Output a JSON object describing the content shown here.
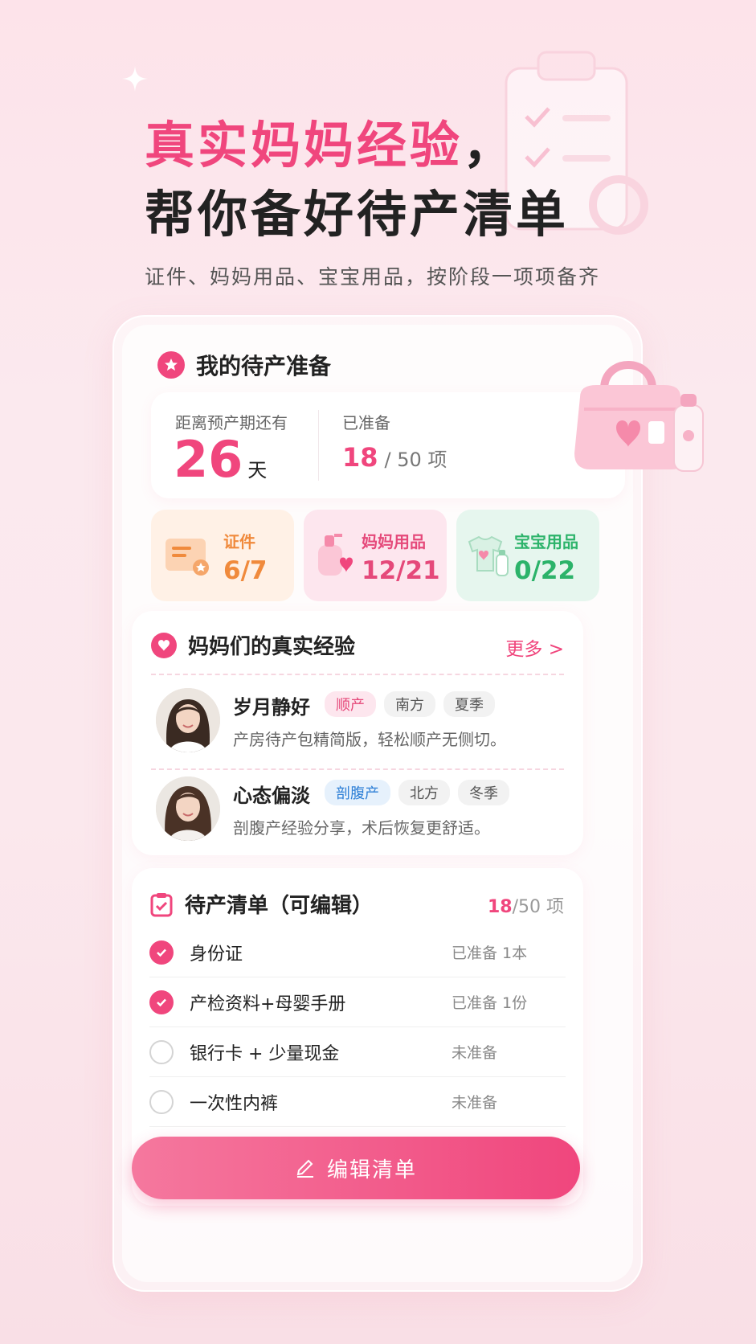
{
  "hero": {
    "line1_highlight": "真实妈妈经验",
    "line1_punct": "，",
    "line2": "帮你备好待产清单",
    "subtitle": "证件、妈妈用品、宝宝用品，按阶段一项项备齐"
  },
  "prep": {
    "title": "我的待产准备",
    "days_label": "距离预产期还有",
    "days_value": "26",
    "days_unit": "天",
    "ready_label": "已准备",
    "ready_value": "18",
    "ready_rest": "/ 50 项"
  },
  "categories": [
    {
      "label": "证件",
      "value": "6/7",
      "icon": "certificate-icon"
    },
    {
      "label": "妈妈用品",
      "value": "12/21",
      "icon": "lotion-icon"
    },
    {
      "label": "宝宝用品",
      "value": "0/22",
      "icon": "baby-clothes-icon"
    }
  ],
  "experience": {
    "title": "妈妈们的真实经验",
    "more": "更多 >",
    "items": [
      {
        "name": "岁月静好",
        "tags": [
          "顺产",
          "南方",
          "夏季"
        ],
        "desc": "产房待产包精简版，轻松顺产无侧切。"
      },
      {
        "name": "心态偏淡",
        "tags": [
          "剖腹产",
          "北方",
          "冬季"
        ],
        "desc": "剖腹产经验分享，术后恢复更舒适。"
      }
    ]
  },
  "checklist": {
    "title": "待产清单（可编辑）",
    "count_done": "18",
    "count_rest": "/50 项",
    "items": [
      {
        "label": "身份证",
        "status": "已准备 1本",
        "checked": true
      },
      {
        "label": "产检资料+母婴手册",
        "status": "已准备 1份",
        "checked": true
      },
      {
        "label": "银行卡 + 少量现金",
        "status": "未准备",
        "checked": false
      },
      {
        "label": "一次性内裤",
        "status": "未准备",
        "checked": false
      }
    ]
  },
  "edit_button": {
    "label": "编辑清单"
  },
  "colors": {
    "accent": "#f0467d",
    "orange": "#f08a3c",
    "green": "#2cb36a",
    "blue": "#2d7fd6"
  }
}
